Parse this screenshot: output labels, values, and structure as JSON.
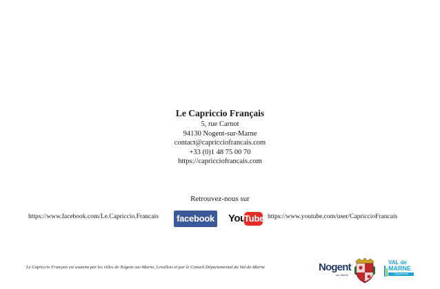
{
  "organization": {
    "name": "Le Capriccio Français",
    "address_line1": "5, rue Carnot",
    "address_line2": "94130 Nogent-sur-Marne",
    "email": "contact@capricciofrancais.com",
    "phone": "+33 (0)1 48 75 00 70",
    "website": "https://capricciofrancais.com"
  },
  "social": {
    "heading": "Retrouvez-nous sur",
    "facebook": {
      "url": "https://www.facebook.com/Le.Capriccio.Francais",
      "logo_text": "facebook",
      "icon": "facebook-logo",
      "color": "#3b5998"
    },
    "youtube": {
      "url": "https://www.youtube.com/user/CapriccioFrancais",
      "logo_you": "You",
      "logo_tube": "Tube",
      "icon": "youtube-logo",
      "color": "#e52d27"
    }
  },
  "footer": {
    "support_text": "Le Capriccio Français est soutenu par les villes de Nogent-sur-Marne, Levallois et par le Conseil Départemental du Val-de-Marne",
    "logos": {
      "nogent": {
        "name": "Nogent",
        "tagline": "sur Marne"
      },
      "crest": {
        "icon": "city-crest-icon"
      },
      "val_de_marne": {
        "line1": "VAL de",
        "line2": "MARNE",
        "tagline": "Département"
      }
    }
  }
}
